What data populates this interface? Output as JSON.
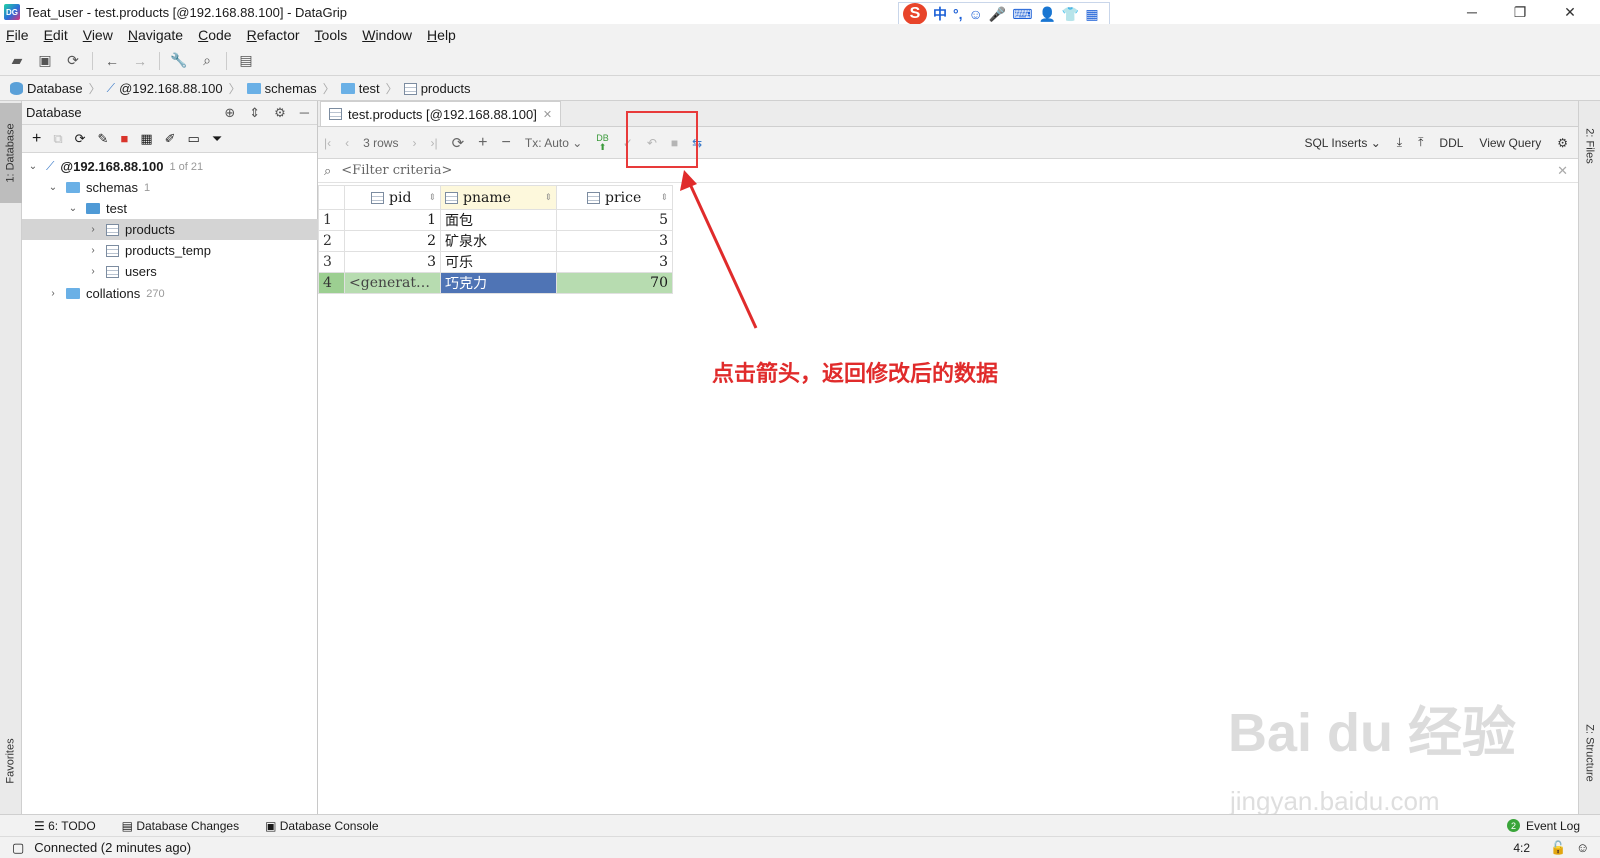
{
  "window": {
    "title": "Teat_user - test.products [@192.168.88.100] - DataGrip",
    "app_icon_text": "DG",
    "controls": {
      "minimize": "─",
      "maximize": "❐",
      "close": "✕"
    }
  },
  "ime_toolbar": {
    "logo": "S",
    "items": [
      "中",
      "°,",
      "☺",
      "🎤",
      "⌨",
      "👤",
      "👕",
      "▦"
    ]
  },
  "menu": [
    "File",
    "Edit",
    "View",
    "Navigate",
    "Code",
    "Refactor",
    "Tools",
    "Window",
    "Help"
  ],
  "breadcrumb": [
    "Database",
    "@192.168.88.100",
    "schemas",
    "test",
    "products"
  ],
  "left_strip": {
    "database_tab": "1: Database",
    "favorites_tab": "Favorites"
  },
  "right_strip": {
    "files_tab": "2: Files",
    "structure_tab": "Z: Structure"
  },
  "db_panel": {
    "title": "Database",
    "tree": [
      {
        "label": "@192.168.88.100",
        "count": "1 of 21"
      },
      {
        "label": "schemas",
        "count": "1"
      },
      {
        "label": "test"
      },
      {
        "label": "products"
      },
      {
        "label": "products_temp"
      },
      {
        "label": "users"
      },
      {
        "label": "collations",
        "count": "270"
      }
    ]
  },
  "editor": {
    "tab_label": "test.products [@192.168.88.100]",
    "rows_label": "3 rows",
    "tx_label": "Tx: Auto",
    "submit_label": "DB",
    "sql_inserts": "SQL Inserts",
    "ddl": "DDL",
    "view_query": "View Query",
    "filter_placeholder": "<Filter criteria>"
  },
  "grid": {
    "columns": [
      "pid",
      "pname",
      "price"
    ],
    "rows": [
      {
        "num": "1",
        "pid": "1",
        "pname": "面包",
        "price": "5"
      },
      {
        "num": "2",
        "pid": "2",
        "pname": "矿泉水",
        "price": "3"
      },
      {
        "num": "3",
        "pid": "3",
        "pname": "可乐",
        "price": "3"
      },
      {
        "num": "4",
        "pid": "<generat…",
        "pname": "巧克力",
        "price": "70"
      }
    ]
  },
  "annotation": {
    "text": "点击箭头，返回修改后的数据",
    "color": "#e02b2b"
  },
  "watermark": {
    "main": "Bai du 经验",
    "sub": "jingyan.baidu.com"
  },
  "bottom_tabs": {
    "todo": "6: TODO",
    "db_changes": "Database Changes",
    "db_console": "Database Console",
    "event_log": "Event Log",
    "event_count": "2"
  },
  "status": {
    "text": "Connected (2 minutes ago)",
    "position": "4:2"
  },
  "colors": {
    "new_row": "#b7dcb0",
    "selected_cell": "#4f74b5",
    "header_highlight": "#fdf8dc"
  }
}
